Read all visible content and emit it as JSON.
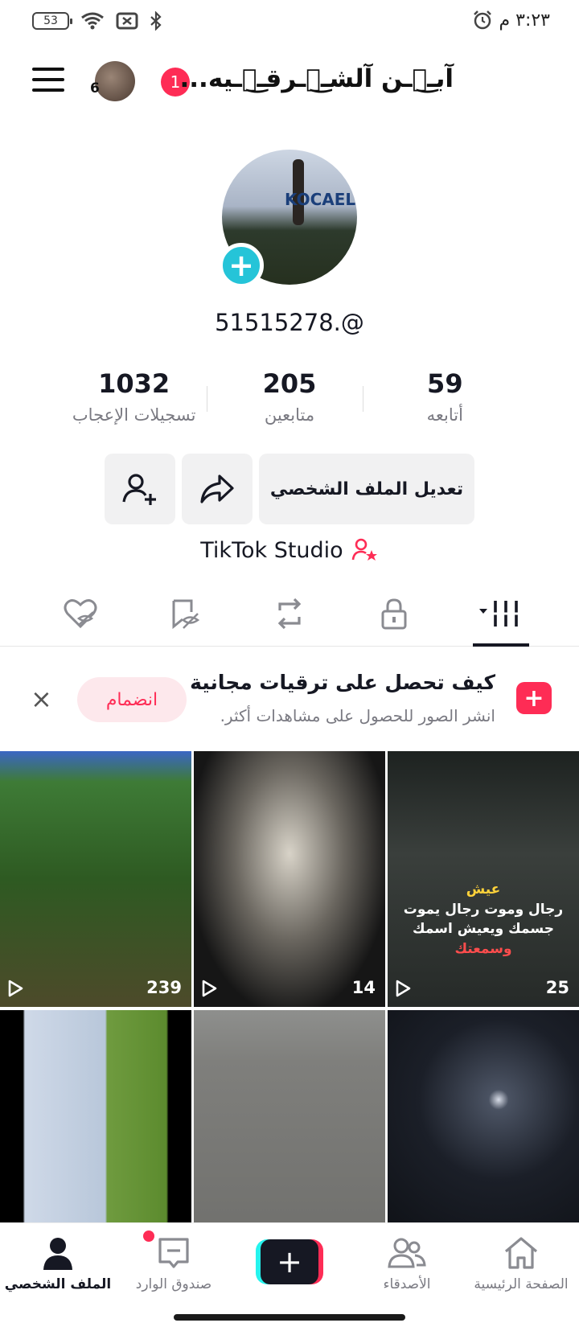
{
  "status_bar": {
    "battery": "53",
    "time": "٣:٢٣ م"
  },
  "header": {
    "avatar_badge": "6",
    "notification_count": "1",
    "username": "آبـ๋͜ـن آلشـ๋͜ـرقـ๋͜ـيه..."
  },
  "profile": {
    "photo_sign": "KOCAELİ",
    "handle": "51515278.@",
    "stats": [
      {
        "value": "1032",
        "label": "تسجيلات الإعجاب"
      },
      {
        "value": "205",
        "label": "متابعين"
      },
      {
        "value": "59",
        "label": "أتابعه"
      }
    ],
    "edit_button": "تعديل الملف الشخصي",
    "studio_label": "TikTok Studio"
  },
  "promo": {
    "title": "كيف تحصل على ترقيات مجانية",
    "subtitle": "انشر الصور للحصول على مشاهدات أكثر.",
    "join_label": "انضمام",
    "close_label": "×"
  },
  "videos": [
    {
      "views": "239"
    },
    {
      "views": "14"
    },
    {
      "views": "25",
      "caption_line1": "عيش",
      "caption_line2": "رجال وموت رجال يموت",
      "caption_line3": "جسمك ويعيش اسمك",
      "caption_line4": "وسمعتك"
    }
  ],
  "nav": {
    "profile": "الملف الشخصي",
    "inbox": "صندوق الوارد",
    "create": "+",
    "friends": "الأصدقاء",
    "home": "الصفحة الرئيسية"
  },
  "colors": {
    "accent": "#fe2c55",
    "teal": "#25c4d8",
    "text": "#161823",
    "muted": "#7a7a82"
  }
}
